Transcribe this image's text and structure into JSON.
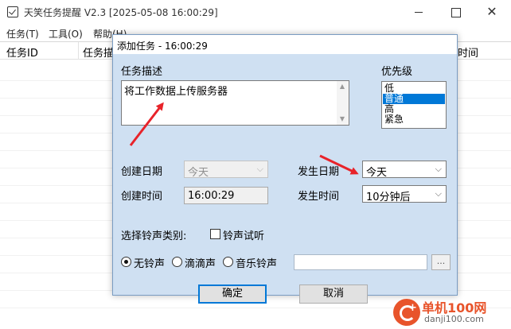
{
  "app": {
    "title": "天笑任务提醒 V2.3 [2025-05-08 16:00:29]"
  },
  "menu": {
    "task": "任务(T)",
    "tools": "工具(O)",
    "help": "帮助(H)"
  },
  "list": {
    "columns": [
      "任务ID",
      "任务描",
      "时间"
    ]
  },
  "dialog": {
    "title": "添加任务 - 16:00:29",
    "desc_label": "任务描述",
    "desc_value": "将工作数据上传服务器",
    "priority_label": "优先级",
    "priority_options": [
      "低",
      "普通",
      "高",
      "紧急"
    ],
    "priority_selected": "普通",
    "create_date_label": "创建日期",
    "create_date_value": "今天",
    "create_time_label": "创建时间",
    "create_time_value": "16:00:29",
    "occur_date_label": "发生日期",
    "occur_date_value": "今天",
    "occur_time_label": "发生时间",
    "occur_time_value": "10分钟后",
    "sound_type_label": "选择铃声类别:",
    "sound_test_label": "铃声试听",
    "sound_options": [
      "无铃声",
      "滴滴声",
      "音乐铃声"
    ],
    "sound_selected": "无铃声",
    "browse_label": "...",
    "ok_label": "确定",
    "cancel_label": "取消"
  },
  "watermark": {
    "name": "单机100网",
    "url": "danji100.com"
  },
  "colors": {
    "dialog_bg": "#cfe0f2",
    "selection": "#0078d7",
    "annotation_arrow": "#e8232a",
    "watermark": "#e8542b"
  },
  "icons": [
    "app-checklist-icon",
    "minimize-icon",
    "maximize-icon",
    "close-icon",
    "dropdown-arrow-icon"
  ]
}
